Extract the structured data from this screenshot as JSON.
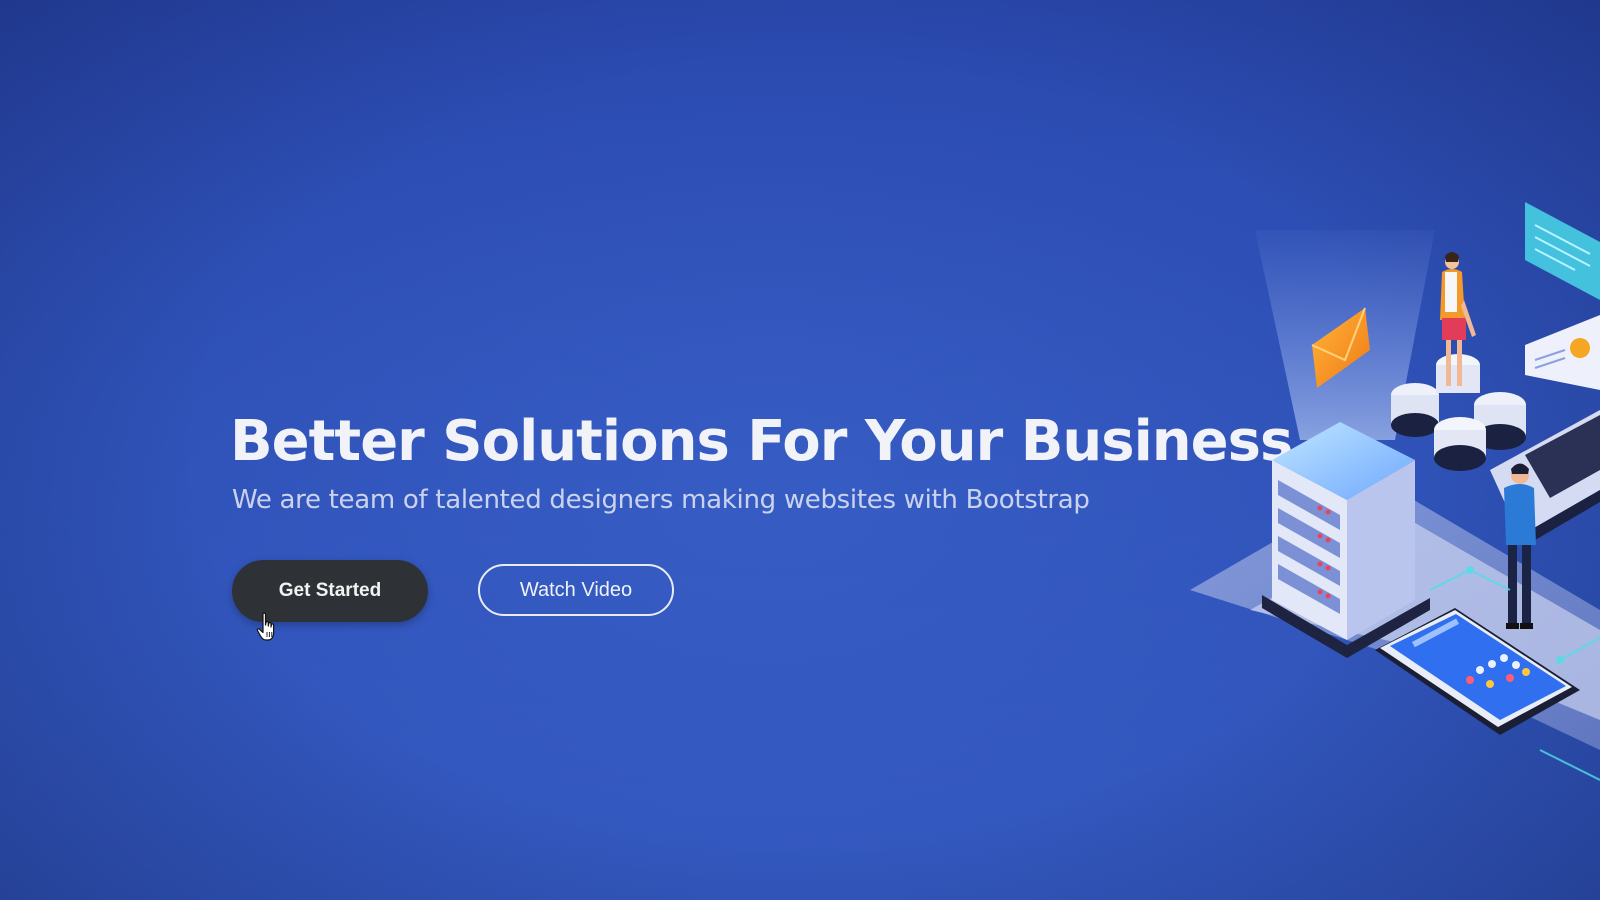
{
  "hero": {
    "title": "Better Solutions For Your Business",
    "subtitle": "We are team of talented designers making websites with Bootstrap",
    "get_started_label": "Get Started",
    "watch_video_label": "Watch Video"
  },
  "illustration": {
    "name": "isometric-data-center-illustration"
  },
  "colors": {
    "background": "#2f52b8",
    "primary_button": "#2e3236",
    "text": "#f1f3f8"
  },
  "icons": {
    "cursor": "hand-pointer-cursor"
  }
}
